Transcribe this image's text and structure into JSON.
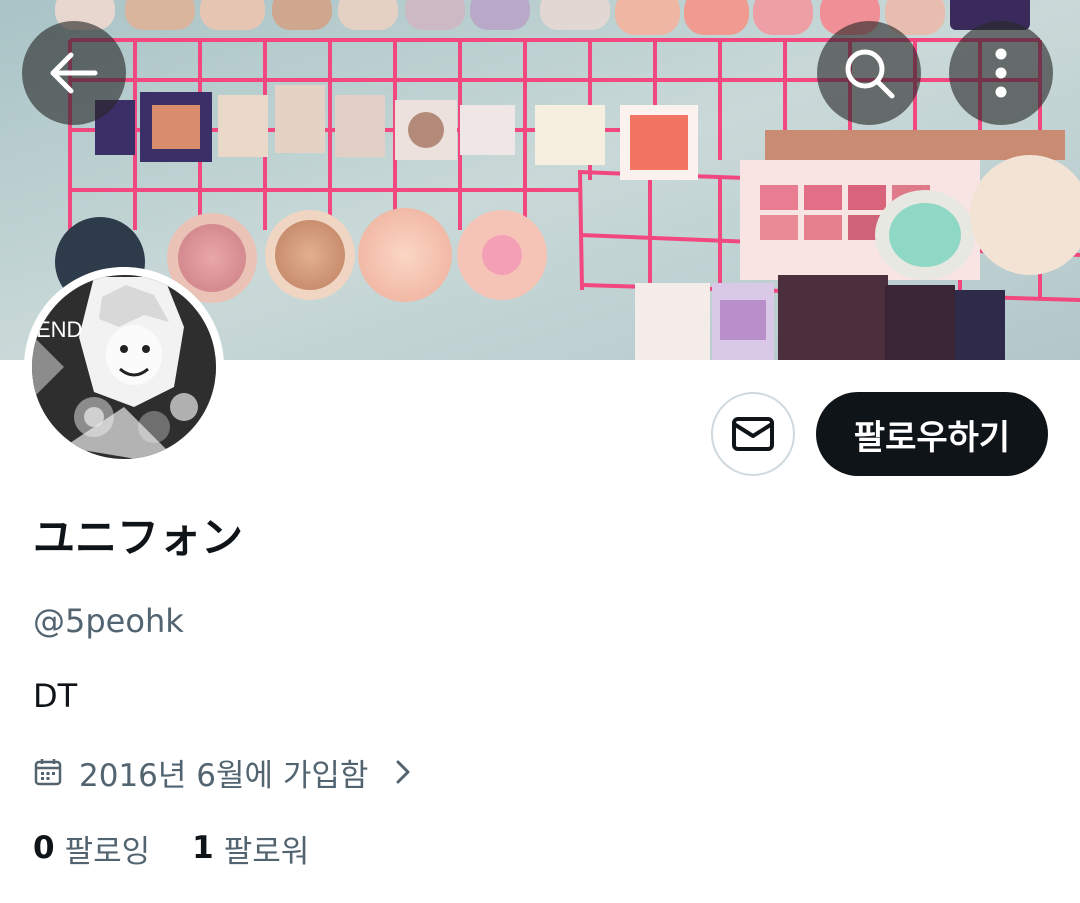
{
  "header": {
    "back_icon": "arrow-left-icon",
    "search_icon": "search-icon",
    "more_icon": "more-vertical-icon"
  },
  "banner": {
    "description_icon": "cosmetics-photo",
    "avatar_text": "END"
  },
  "actions": {
    "message_icon": "envelope-icon",
    "follow_label": "팔로우하기"
  },
  "profile": {
    "display_name": "ユニフォン",
    "handle": "@5peohk",
    "bio": "DT",
    "joined": "2016년 6월에 가입함",
    "following_count": "0",
    "following_label": "팔로잉",
    "followers_count": "1",
    "followers_label": "팔로워"
  },
  "colors": {
    "text_primary": "#0f1419",
    "text_secondary": "#536471",
    "button_dark": "#0f1419",
    "border": "#cfd9de",
    "grid_pink": "#f2477f"
  }
}
